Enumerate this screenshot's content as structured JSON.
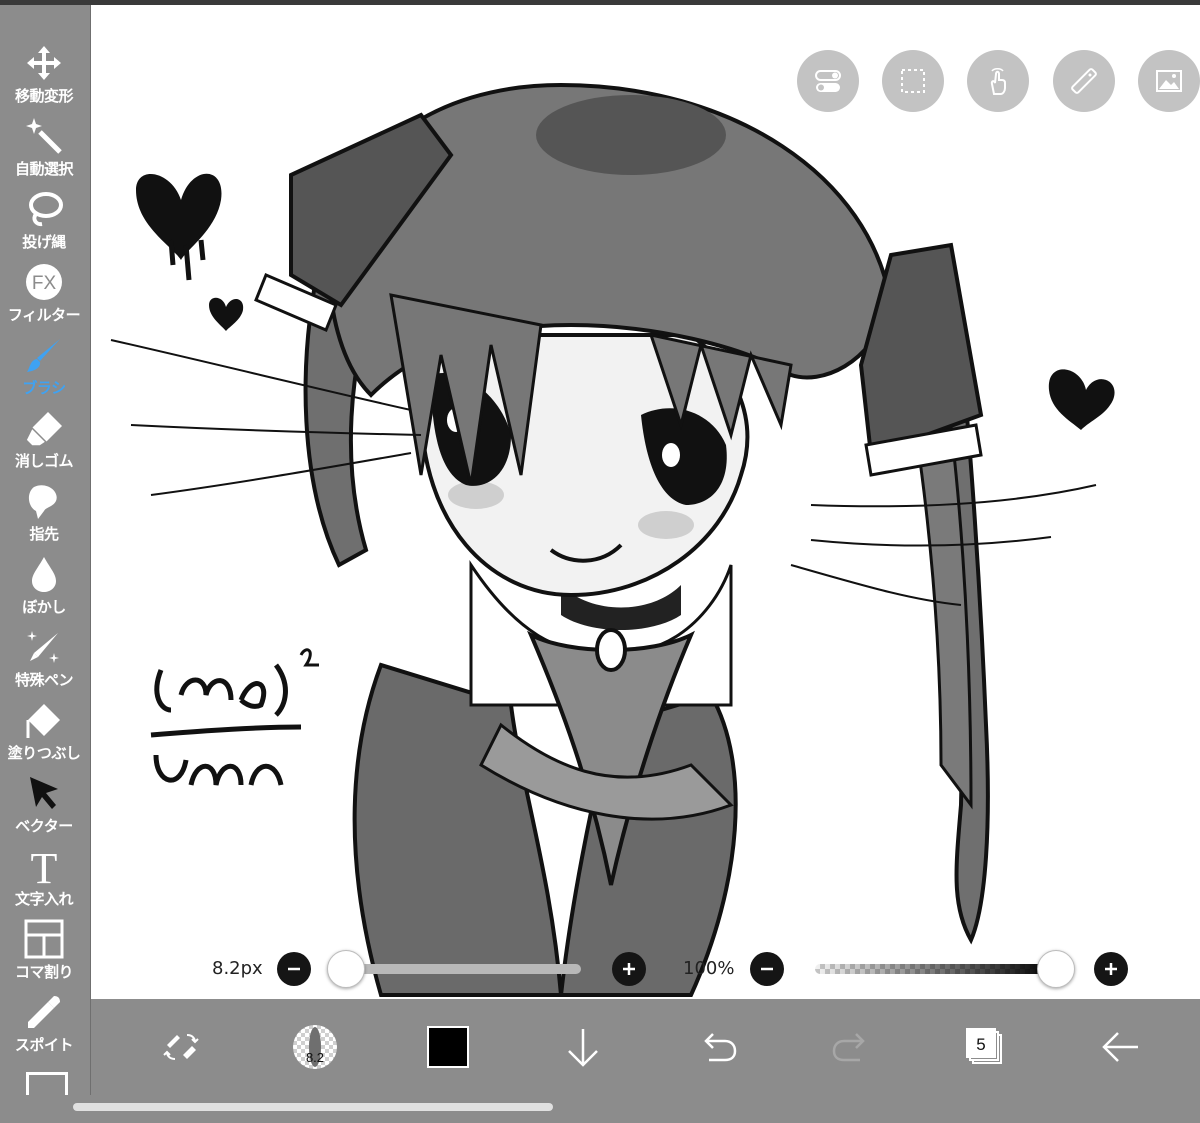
{
  "sidebar": {
    "tools": [
      {
        "id": "move",
        "label": "移動変形",
        "icon": "move-arrows-icon",
        "active": false
      },
      {
        "id": "autoselect",
        "label": "自動選択",
        "icon": "magic-wand-icon",
        "active": false
      },
      {
        "id": "lasso",
        "label": "投げ縄",
        "icon": "lasso-icon",
        "active": false
      },
      {
        "id": "filter",
        "label": "フィルター",
        "icon": "fx-icon",
        "icon_text": "FX",
        "active": false
      },
      {
        "id": "brush",
        "label": "ブラシ",
        "icon": "brush-icon",
        "active": true
      },
      {
        "id": "eraser",
        "label": "消しゴム",
        "icon": "eraser-icon",
        "active": false
      },
      {
        "id": "smudge",
        "label": "指先",
        "icon": "smudge-finger-icon",
        "active": false
      },
      {
        "id": "blur",
        "label": "ぼかし",
        "icon": "droplet-icon",
        "active": false
      },
      {
        "id": "specialpen",
        "label": "特殊ペン",
        "icon": "sparkle-pen-icon",
        "active": false
      },
      {
        "id": "fill",
        "label": "塗りつぶし",
        "icon": "bucket-fill-icon",
        "active": false
      },
      {
        "id": "vector",
        "label": "ベクター",
        "icon": "cursor-arrow-icon",
        "active": false
      },
      {
        "id": "text",
        "label": "文字入れ",
        "icon": "text-t-icon",
        "icon_text": "T",
        "active": false
      },
      {
        "id": "frame",
        "label": "コマ割り",
        "icon": "panel-frame-icon",
        "active": false
      },
      {
        "id": "eyedropper",
        "label": "スポイト",
        "icon": "eyedropper-icon",
        "active": false
      }
    ],
    "colors": {
      "bg": "#8c8c8c",
      "label": "#ffffff",
      "active": "#3fa2f2"
    }
  },
  "floating_buttons": [
    {
      "id": "toggle",
      "icon": "toggle-switch-icon"
    },
    {
      "id": "selection",
      "icon": "dashed-selection-icon"
    },
    {
      "id": "gesture",
      "icon": "hand-touch-icon"
    },
    {
      "id": "ruler",
      "icon": "ruler-icon"
    },
    {
      "id": "material",
      "icon": "image-material-icon"
    }
  ],
  "sliders": {
    "size": {
      "label": "8.2px",
      "value": 8.2,
      "fraction": 0.01,
      "minus_icon": "minus-icon",
      "plus_icon": "plus-icon"
    },
    "opacity": {
      "label": "100%",
      "value": 100,
      "fraction": 1.0,
      "minus_icon": "minus-icon",
      "plus_icon": "plus-icon"
    }
  },
  "bottombar": {
    "items": [
      {
        "id": "swap",
        "icon": "swap-tools-icon"
      },
      {
        "id": "brush-preview",
        "icon": "brush-preview-icon",
        "text": "8.2"
      },
      {
        "id": "color",
        "icon": "color-swatch",
        "color": "#000000"
      },
      {
        "id": "download",
        "icon": "down-arrow-icon"
      },
      {
        "id": "undo",
        "icon": "undo-icon"
      },
      {
        "id": "redo",
        "icon": "redo-icon"
      },
      {
        "id": "layers",
        "icon": "layers-icon",
        "text": "5"
      },
      {
        "id": "back",
        "icon": "back-arrow-icon"
      }
    ]
  },
  "canvas": {
    "bg": "#ffffff",
    "artwork": "chibi-girl-sketch"
  }
}
